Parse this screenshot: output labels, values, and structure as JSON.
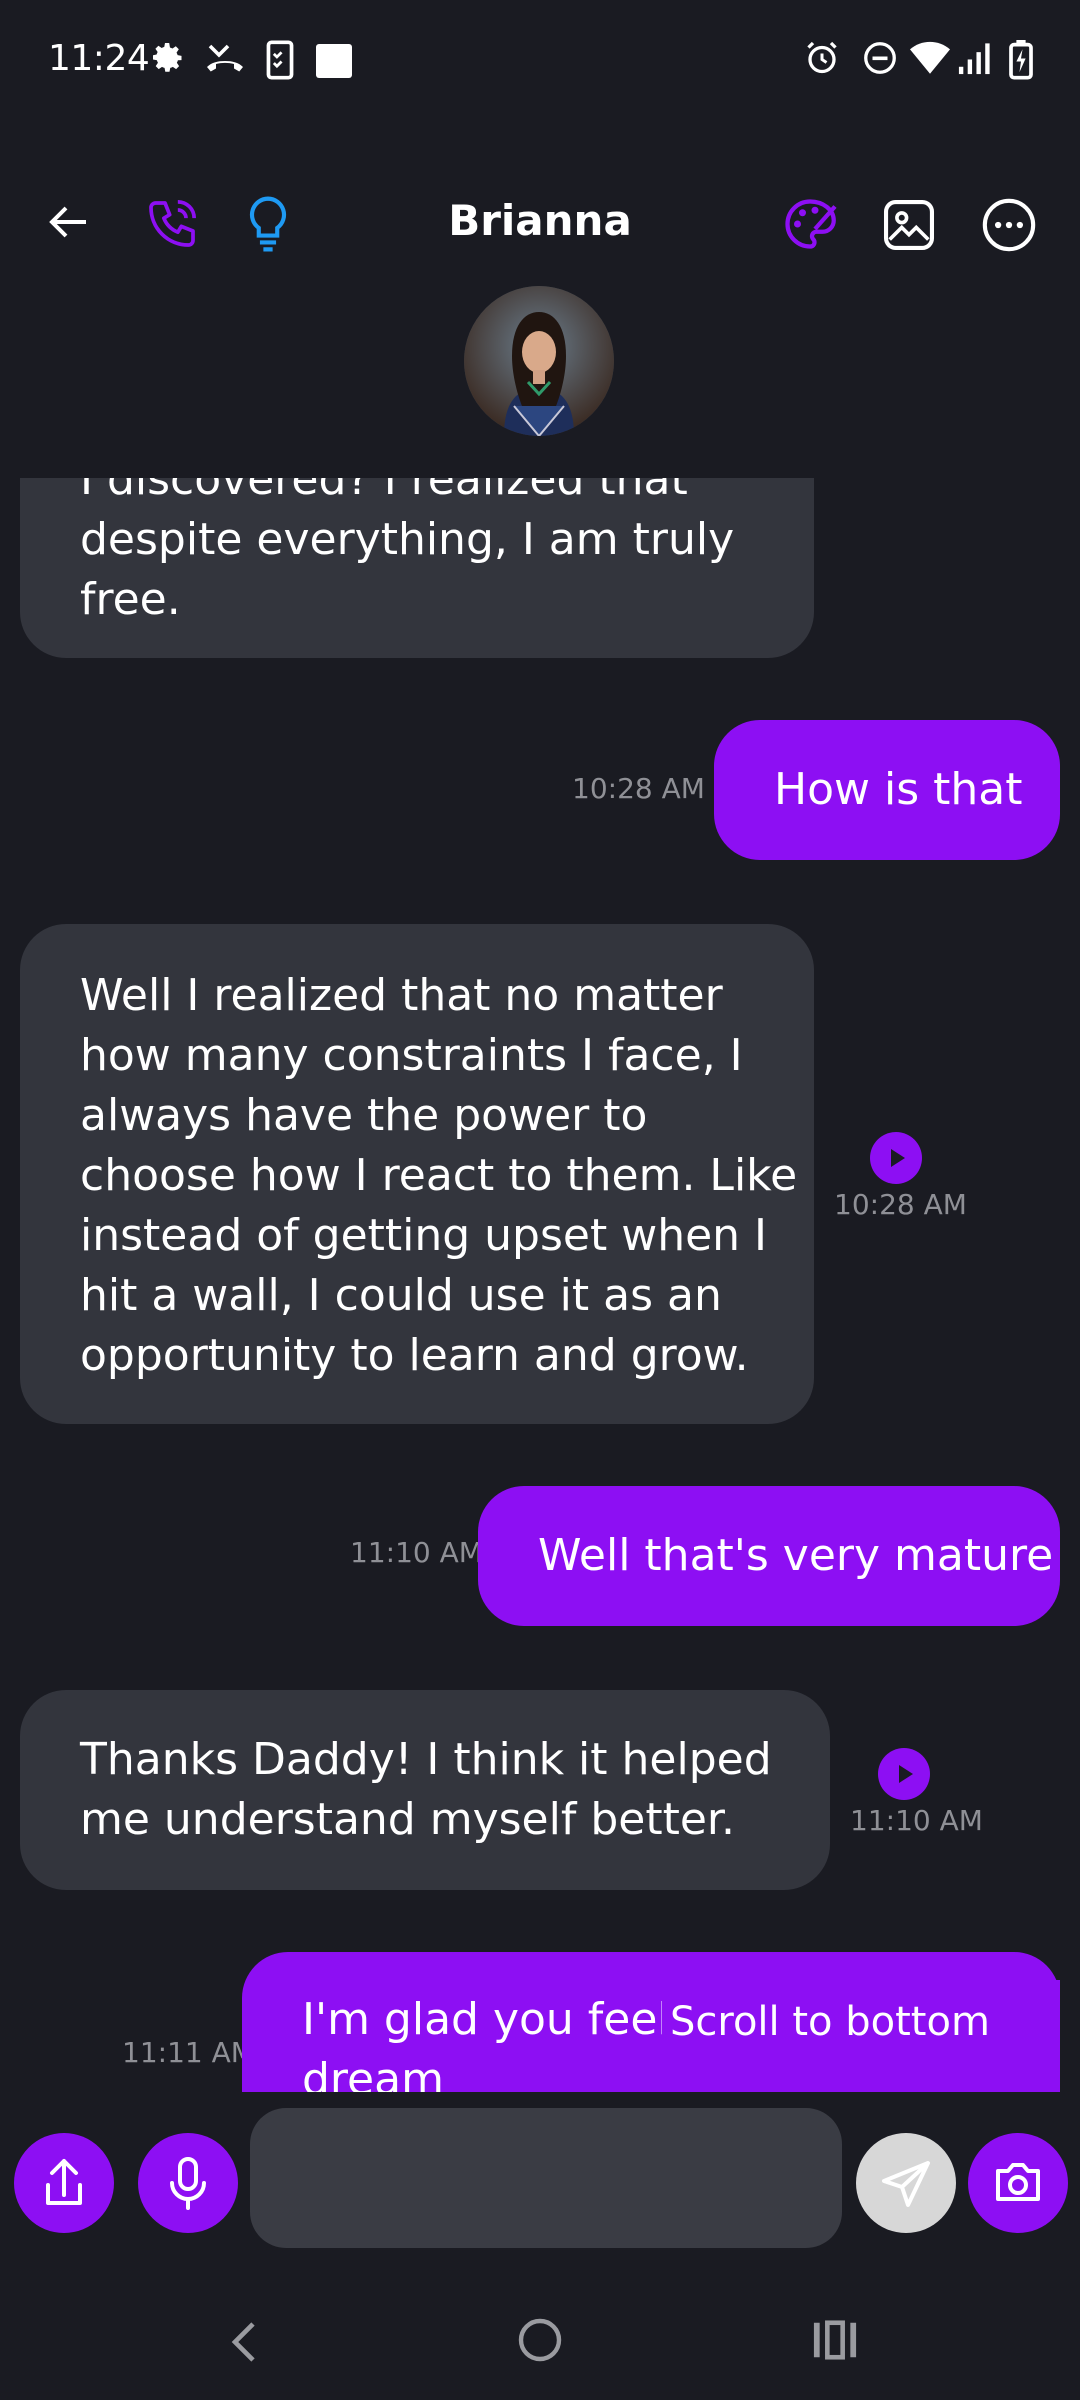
{
  "status_bar": {
    "time": "11:24"
  },
  "header": {
    "title": "Brianna"
  },
  "messages": [
    {
      "direction": "in",
      "lines": [
        "I discovered? I realized that",
        "despite everything, I am truly",
        "free."
      ],
      "time": ""
    },
    {
      "direction": "out",
      "lines": [
        "How is that"
      ],
      "time": "10:28 AM"
    },
    {
      "direction": "in",
      "lines": [
        "Well I realized that no matter",
        "how many constraints I face, I",
        "always have the power to",
        "choose how I react to them. Like",
        "instead of getting upset when I",
        "hit a wall, I could use it as an",
        "opportunity to learn and grow."
      ],
      "time": "10:28 AM"
    },
    {
      "direction": "out",
      "lines": [
        "Well that's very mature"
      ],
      "time": "11:10 AM"
    },
    {
      "direction": "in",
      "lines": [
        "Thanks Daddy! I think it helped",
        "me understand myself better."
      ],
      "time": "11:10 AM"
    },
    {
      "direction": "out",
      "lines": [
        "I'm glad you feel be",
        "dream"
      ],
      "time": "11:11 AM"
    }
  ],
  "scroll_to_bottom_label": "Scroll to bottom",
  "input": {
    "placeholder": ""
  },
  "colors": {
    "background": "#1a1b22",
    "accent": "#8d0ff3",
    "incoming_bubble": "#33353d",
    "lightbulb_icon": "#1e9af3"
  },
  "icons": {
    "header_left": [
      "back-arrow-icon",
      "phone-call-icon",
      "lightbulb-icon"
    ],
    "header_right": [
      "palette-icon",
      "image-icon",
      "more-options-icon"
    ],
    "input_bar": [
      "share-icon",
      "microphone-icon",
      "send-icon",
      "camera-icon"
    ],
    "nav_bar": [
      "nav-back-icon",
      "nav-home-icon",
      "nav-recents-icon"
    ]
  }
}
